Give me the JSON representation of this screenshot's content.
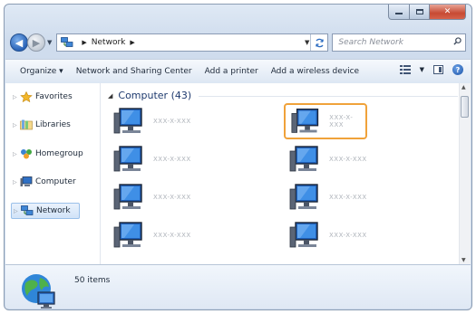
{
  "address": {
    "root_label": "Network"
  },
  "search": {
    "placeholder": "Search Network"
  },
  "toolbar": {
    "organize_label": "Organize ▾",
    "network_center_label": "Network and Sharing Center",
    "add_printer_label": "Add a printer",
    "add_wireless_label": "Add a wireless device"
  },
  "sidebar": {
    "items": [
      {
        "label": "Favorites",
        "icon": "star-icon"
      },
      {
        "label": "Libraries",
        "icon": "libraries-icon"
      },
      {
        "label": "Homegroup",
        "icon": "homegroup-icon"
      },
      {
        "label": "Computer",
        "icon": "computer-icon"
      },
      {
        "label": "Network",
        "icon": "network-icon",
        "selected": true
      }
    ]
  },
  "main": {
    "group_title": "Computer (43)",
    "computers": [
      {
        "name": "XXX-X-XXX"
      },
      {
        "name": "XXX-X-XXX",
        "selected": true
      },
      {
        "name": "XXX-X-XXX"
      },
      {
        "name": "XXX-X-XXX"
      },
      {
        "name": "XXX-X-XXX"
      },
      {
        "name": "XXX-X-XXX"
      },
      {
        "name": "XXX-X-XXX"
      },
      {
        "name": "XXX-X-XXX"
      }
    ]
  },
  "details": {
    "item_count": "50 items"
  },
  "colors": {
    "selection_highlight": "#f0a23a",
    "accent": "#2a63b7"
  }
}
